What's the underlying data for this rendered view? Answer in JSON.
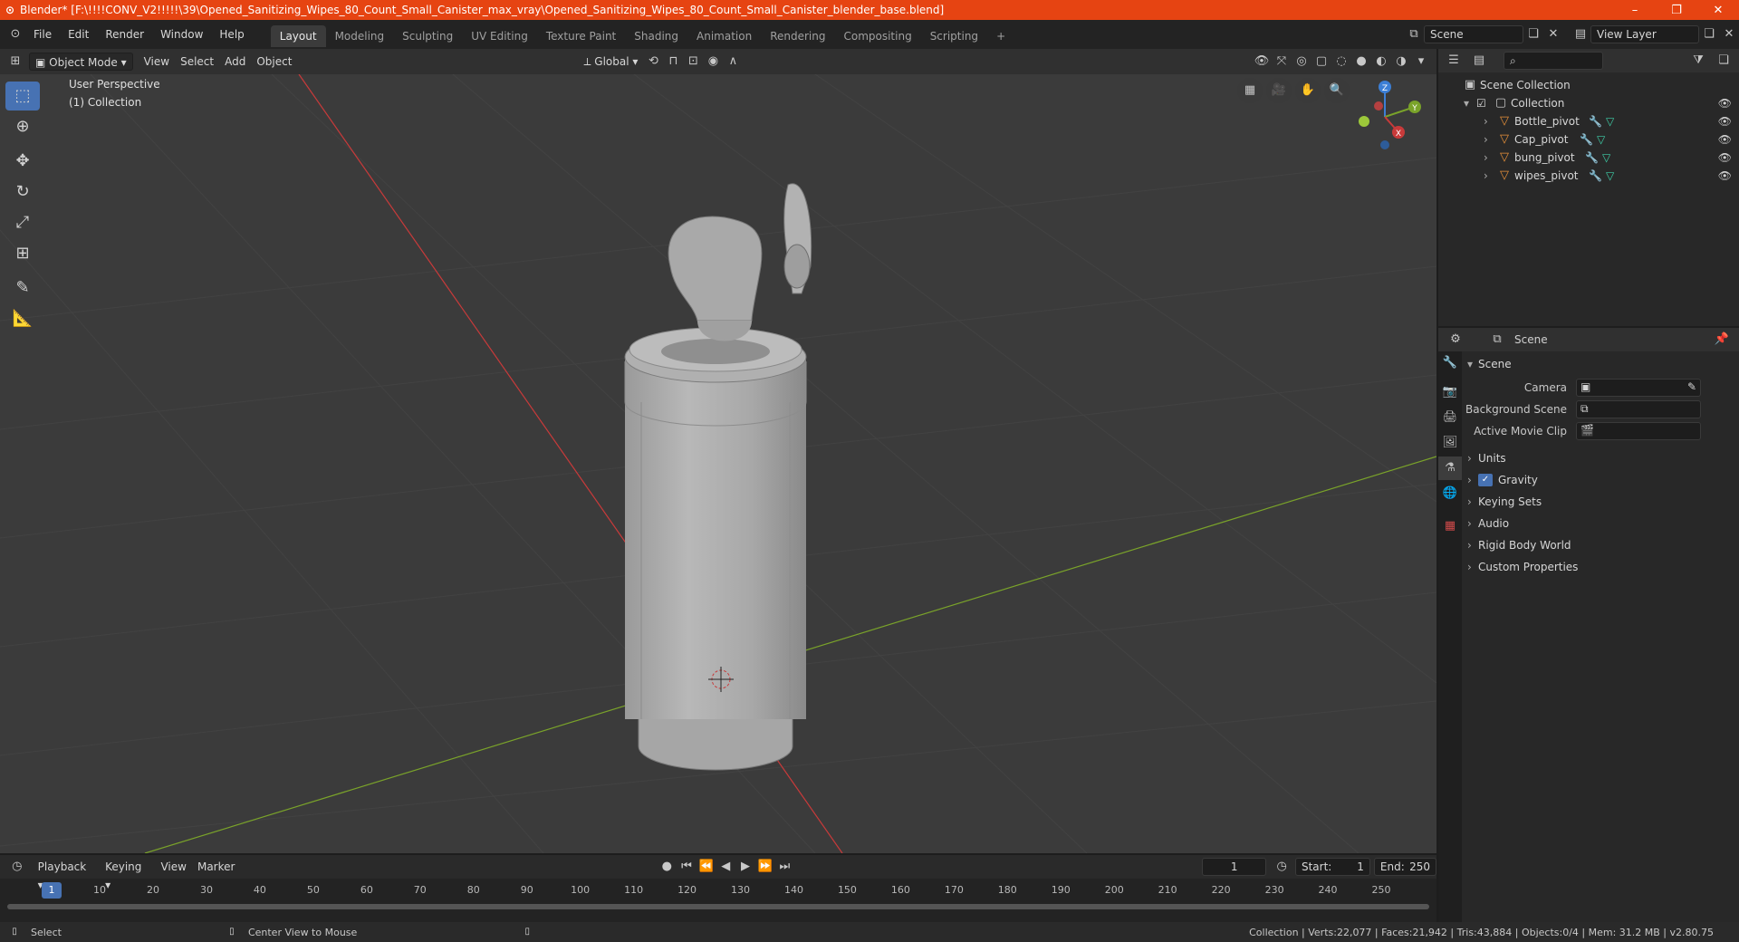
{
  "window": {
    "title": "Blender* [F:\\!!!!CONV_V2!!!!!\\39\\Opened_Sanitizing_Wipes_80_Count_Small_Canister_max_vray\\Opened_Sanitizing_Wipes_80_Count_Small_Canister_blender_base.blend]",
    "minimize": "–",
    "restore": "❐",
    "close": "✕"
  },
  "menu": [
    "File",
    "Edit",
    "Render",
    "Window",
    "Help"
  ],
  "workspaces": [
    {
      "label": "Layout",
      "active": true
    },
    {
      "label": "Modeling"
    },
    {
      "label": "Sculpting"
    },
    {
      "label": "UV Editing"
    },
    {
      "label": "Texture Paint"
    },
    {
      "label": "Shading"
    },
    {
      "label": "Animation"
    },
    {
      "label": "Rendering"
    },
    {
      "label": "Compositing"
    },
    {
      "label": "Scripting"
    }
  ],
  "add_workspace": "+",
  "scene_field": "Scene",
  "view_layer_field": "View Layer",
  "viewport": {
    "mode": "Object Mode",
    "menus": [
      "View",
      "Select",
      "Add",
      "Object"
    ],
    "orientation": "Global",
    "overlay_title": "User Perspective",
    "overlay_collection": "(1) Collection",
    "gizmo": {
      "z": "Z",
      "y": "Y",
      "x": "X"
    }
  },
  "outliner": {
    "search_placeholder": "",
    "scene_collection": "Scene Collection",
    "collection": "Collection",
    "objects": [
      "Bottle_pivot",
      "Cap_pivot",
      "bung_pivot",
      "wipes_pivot"
    ]
  },
  "properties": {
    "context": "Scene",
    "panel": "Scene",
    "fields": [
      {
        "label": "Camera"
      },
      {
        "label": "Background Scene"
      },
      {
        "label": "Active Movie Clip"
      }
    ],
    "subpanels": [
      "Units",
      "Gravity",
      "Keying Sets",
      "Audio",
      "Rigid Body World",
      "Custom Properties"
    ],
    "gravity_checked": true
  },
  "timeline": {
    "menus": [
      "Playback",
      "Keying",
      "View",
      "Marker"
    ],
    "current_frame": "1",
    "start_label": "Start:",
    "start": "1",
    "end_label": "End:",
    "end": "250",
    "ticks": [
      "1",
      "10",
      "20",
      "30",
      "40",
      "50",
      "60",
      "70",
      "80",
      "90",
      "100",
      "110",
      "120",
      "130",
      "140",
      "150",
      "160",
      "170",
      "180",
      "190",
      "200",
      "210",
      "220",
      "230",
      "240",
      "250"
    ]
  },
  "status": {
    "left_action": "Select",
    "middle_action": "Center View to Mouse",
    "stats": "Collection | Verts:22,077 | Faces:21,942 | Tris:43,884 | Objects:0/4 | Mem: 31.2 MB | v2.80.75"
  },
  "colors": {
    "titlebar": "#e64412",
    "accent": "#4772b3",
    "x_axis": "#c83a3a",
    "y_axis": "#7aa32a",
    "z_axis": "#3c7fd6"
  }
}
